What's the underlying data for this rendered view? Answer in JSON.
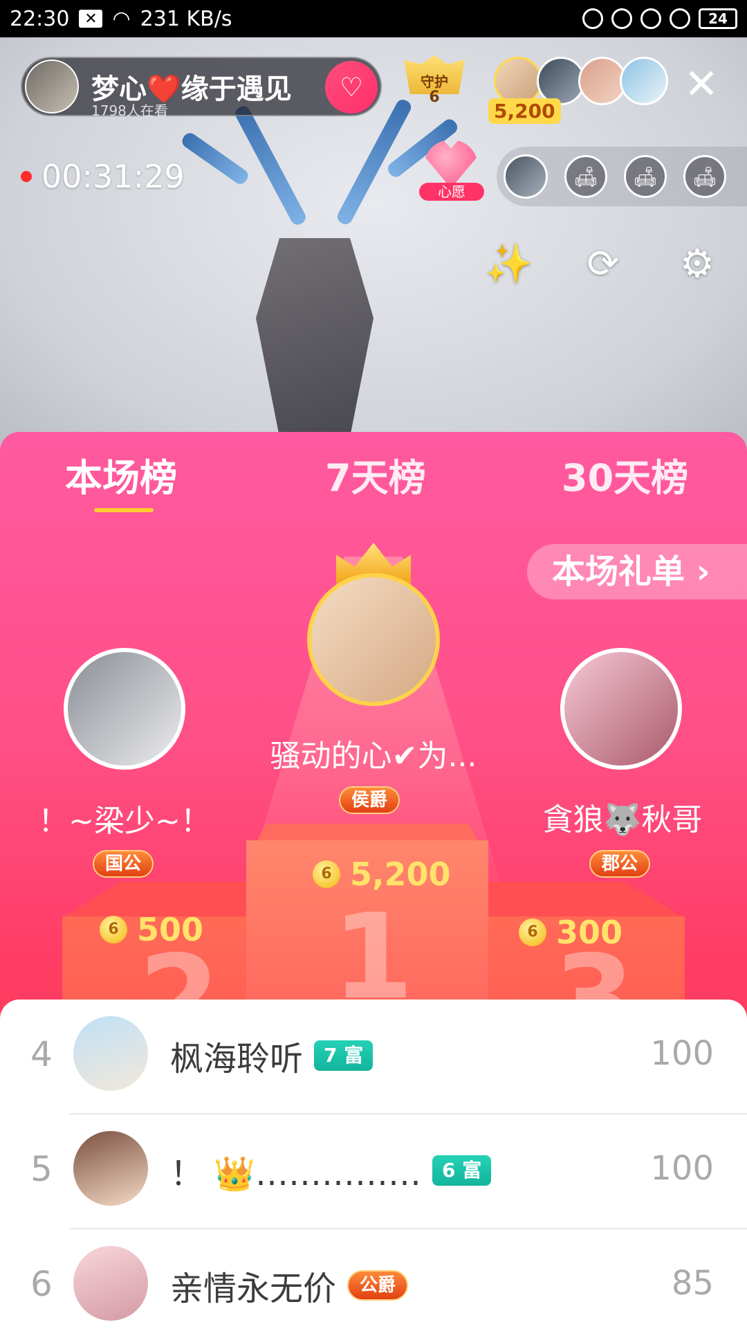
{
  "status_bar": {
    "time": "22:30",
    "speed": "231 KB/s",
    "battery": "24"
  },
  "host": {
    "name": "梦心❤️缘于遇见",
    "viewers": "1798人在看"
  },
  "guard": {
    "label": "守护",
    "count": "6"
  },
  "top_viewer_score": "5,200",
  "live": {
    "timer": "00:31:29"
  },
  "wish": {
    "label": "心愿"
  },
  "tabs": [
    "本场榜",
    "7天榜",
    "30天榜"
  ],
  "gift_list_label": "本场礼单 ›",
  "top3": [
    {
      "rank": "2",
      "name": "！~梁少~！",
      "badge": "国公",
      "score": "500"
    },
    {
      "rank": "1",
      "name": "骚动的心✔为...",
      "badge": "侯爵",
      "score": "5,200"
    },
    {
      "rank": "3",
      "name": "貪狼🐺秋哥",
      "badge": "郡公",
      "score": "300"
    }
  ],
  "list": [
    {
      "rank": "4",
      "name": "枫海聆听",
      "badge": "7 富",
      "badge_type": "wealth",
      "score": "100"
    },
    {
      "rank": "5",
      "name": "！ 👑……………",
      "badge": "6 富",
      "badge_type": "wealth",
      "score": "100"
    },
    {
      "rank": "6",
      "name": "亲情永无价",
      "badge": "公爵",
      "badge_type": "noble",
      "score": "85"
    }
  ],
  "colors": {
    "panel_pink": "#ff5aa0",
    "panel_red": "#ff3a52",
    "gold": "#ffe36a",
    "wealth_teal": "#12b59b"
  },
  "icons": [
    "wifi-icon",
    "bell-off-icon",
    "lock-rotation-icon",
    "alarm-icon",
    "headphones-icon",
    "magic-wand-icon",
    "camera-flip-icon",
    "gear-icon",
    "close-icon",
    "sofa-seat-icon",
    "crown-icon",
    "coin-icon"
  ]
}
